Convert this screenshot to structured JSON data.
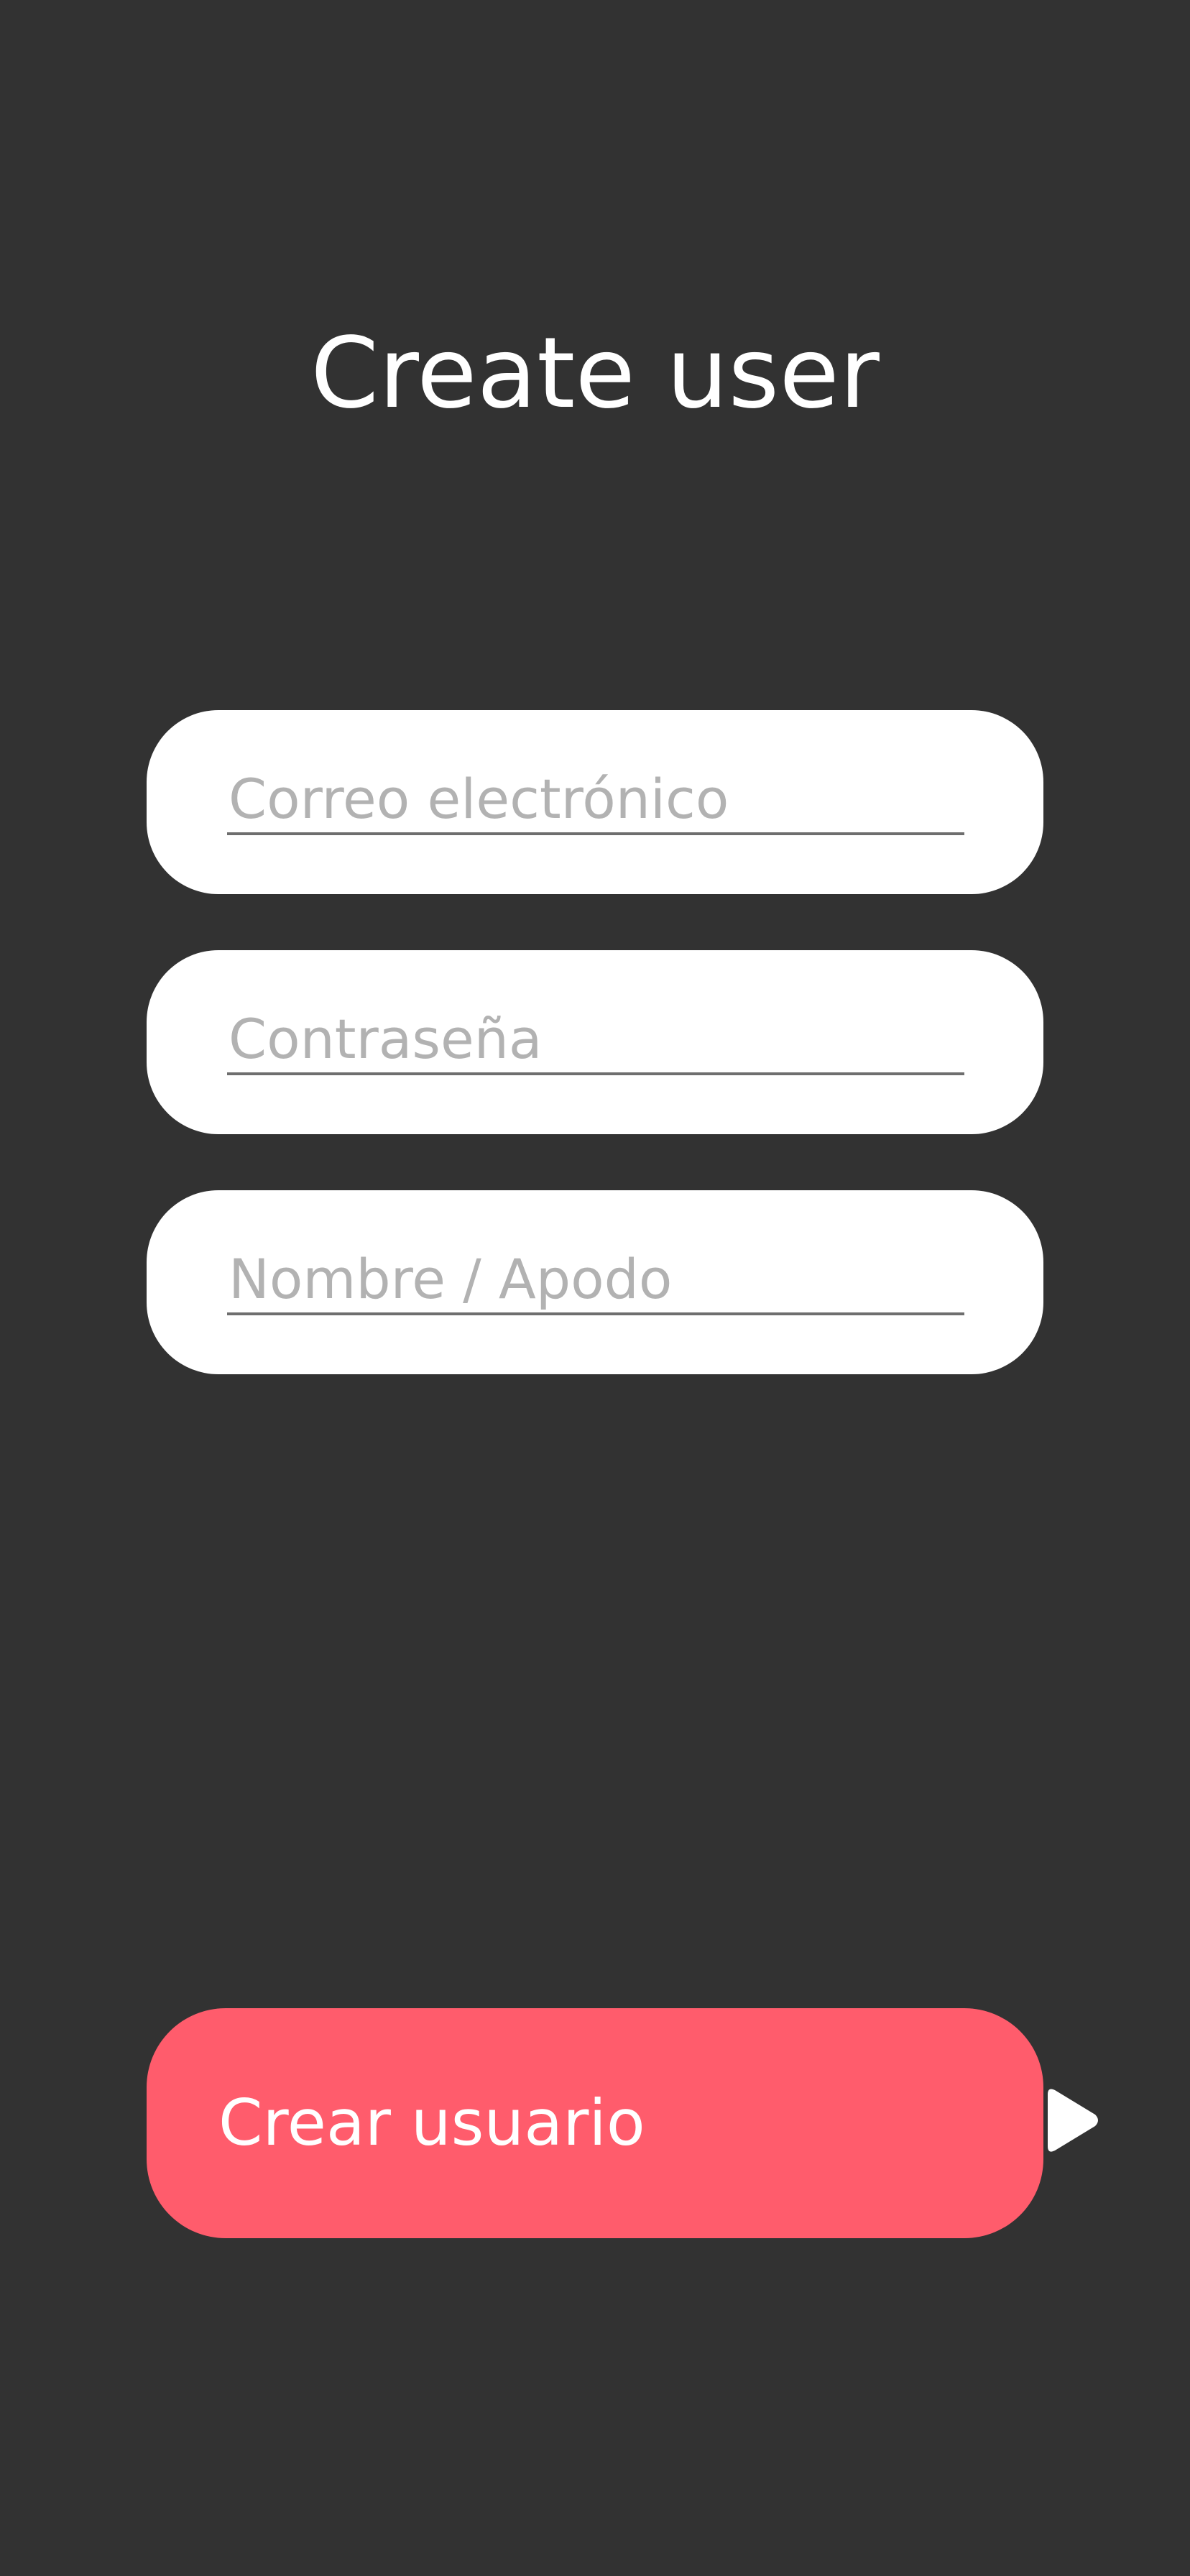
{
  "header": {
    "title": "Create user"
  },
  "form": {
    "email": {
      "value": "",
      "placeholder": "Correo electrónico"
    },
    "password": {
      "value": "",
      "placeholder": "Contraseña"
    },
    "nickname": {
      "value": "",
      "placeholder": "Nombre / Apodo"
    }
  },
  "actions": {
    "submit_label": "Crear usuario",
    "submit_icon": "play-icon"
  },
  "colors": {
    "background": "#323232",
    "field_background": "#ffffff",
    "accent": "#ff5c6c",
    "placeholder": "#b2b2b2",
    "underline": "#6e6e6e"
  }
}
